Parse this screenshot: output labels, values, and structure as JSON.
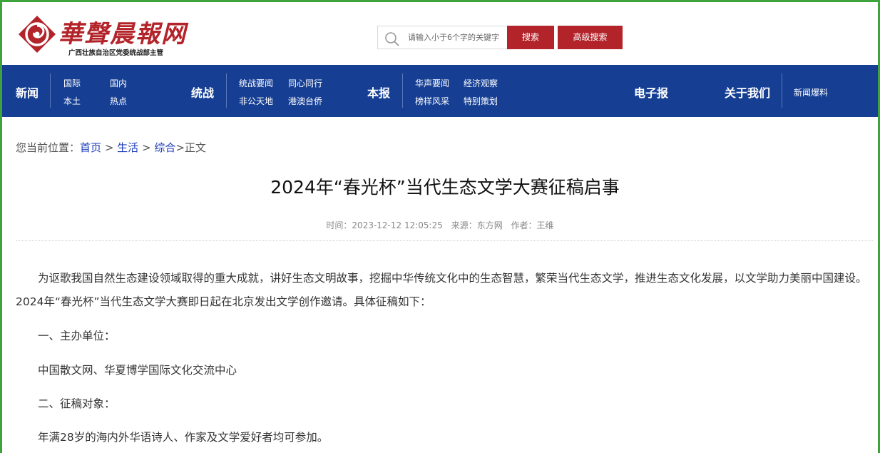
{
  "header": {
    "logo_title": "華聲晨報网",
    "logo_subtitle": "广西壮族自治区党委统战部主管"
  },
  "search": {
    "placeholder": "请输入小于6个字的关键字",
    "search_label": "搜索",
    "advanced_label": "高级搜索"
  },
  "nav": {
    "news": {
      "label": "新闻",
      "links": [
        "国际",
        "国内",
        "本土",
        "热点"
      ]
    },
    "united_front": {
      "label": "统战",
      "links": [
        "统战要闻",
        "同心同行",
        "非公天地",
        "港澳台侨"
      ]
    },
    "paper": {
      "label": "本报",
      "links": [
        "华声要闻",
        "经济观察",
        "榜样风采",
        "特别策划"
      ]
    },
    "epaper": "电子报",
    "about": "关于我们",
    "tips": "新闻爆料"
  },
  "breadcrumb": {
    "prefix": "您当前位置：",
    "items": [
      "首页",
      "生活",
      "综合"
    ],
    "current": "正文",
    "separator": ">"
  },
  "article": {
    "title": "2024年“春光杯”当代生态文学大赛征稿启事",
    "time": "时间：2023-12-12 12:05:25",
    "source": "来源：东方网",
    "author": "作者：王维",
    "paragraphs": [
      "为讴歌我国自然生态建设领域取得的重大成就，讲好生态文明故事，挖掘中华传统文化中的生态智慧，繁荣当代生态文学，推进生态文化发展，以文学助力美丽中国建设。2024年“春光杯”当代生态文学大赛即日起在北京发出文学创作邀请。具体征稿如下：",
      "一、主办单位：",
      "中国散文网、华夏博学国际文化交流中心",
      "二、征稿对象：",
      "年满28岁的海内外华语诗人、作家及文学爱好者均可参加。"
    ]
  },
  "colors": {
    "brand_red": "#b3232a",
    "nav_blue": "#163f94",
    "frame_green": "#3fa33c",
    "link_blue": "#1d3dba"
  }
}
